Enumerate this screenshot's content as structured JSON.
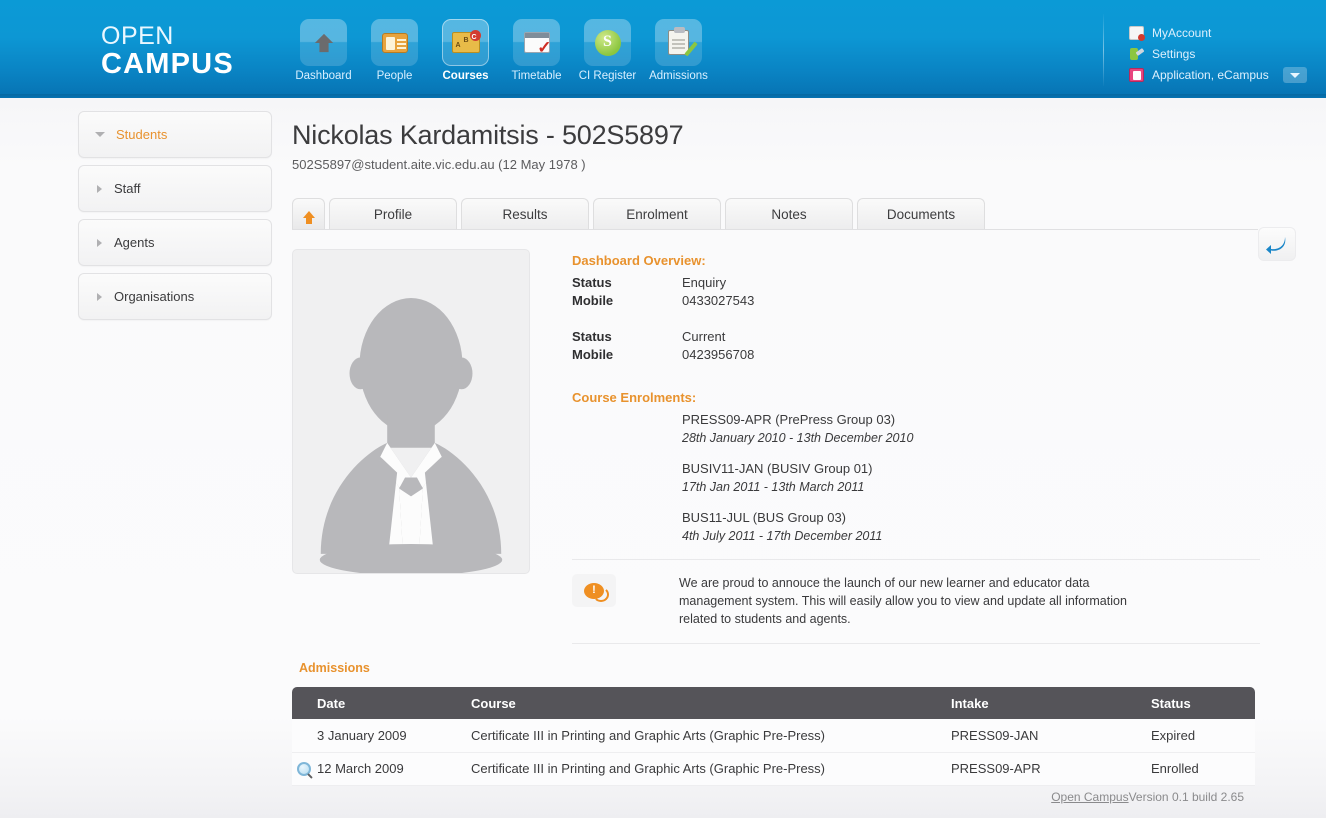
{
  "brand": {
    "line1": "OPEN",
    "line2": "CAMPUS"
  },
  "nav": {
    "items": [
      {
        "label": "Dashboard",
        "icon": "home-icon",
        "active": false
      },
      {
        "label": "People",
        "icon": "id-badge-icon",
        "active": false
      },
      {
        "label": "Courses",
        "icon": "folder-tabs-icon",
        "active": true
      },
      {
        "label": "Timetable",
        "icon": "calendar-check-icon",
        "active": false
      },
      {
        "label": "CI Register",
        "icon": "recycle-s-icon",
        "active": false
      },
      {
        "label": "Admissions",
        "icon": "clipboard-pen-icon",
        "active": false
      }
    ]
  },
  "account": {
    "items": [
      {
        "label": "MyAccount",
        "icon": "account-card-icon",
        "caret": false
      },
      {
        "label": "Settings",
        "icon": "settings-wrench-icon",
        "caret": false
      },
      {
        "label": "Application, eCampus",
        "icon": "application-icon",
        "caret": true
      }
    ]
  },
  "sidebar": {
    "items": [
      {
        "label": "Students",
        "state": "expanded",
        "active": true
      },
      {
        "label": "Staff",
        "state": "collapsed",
        "active": false
      },
      {
        "label": "Agents",
        "state": "collapsed",
        "active": false
      },
      {
        "label": "Organisations",
        "state": "collapsed",
        "active": false
      }
    ]
  },
  "student": {
    "title": "Nickolas Kardamitsis - 502S5897",
    "subtitle": "502S5897@student.aite.vic.edu.au (12 May 1978 )",
    "back_button_icon": "back-arrow-icon",
    "photo_alt": "person-placeholder-avatar"
  },
  "tabs": {
    "home_icon": "home-arrow-icon",
    "items": [
      {
        "label": "Profile",
        "active": false
      },
      {
        "label": "Results",
        "active": false
      },
      {
        "label": "Enrolment",
        "active": false
      },
      {
        "label": "Notes",
        "active": false
      },
      {
        "label": "Documents",
        "active": false
      }
    ]
  },
  "overview": {
    "heading": "Dashboard Overview:",
    "rows": [
      {
        "key": "Status",
        "value": "Enquiry"
      },
      {
        "key": "Mobile",
        "value": "0433027543"
      },
      {
        "key": "Status",
        "value": "Current"
      },
      {
        "key": "Mobile",
        "value": "0423956708"
      }
    ]
  },
  "enrolments": {
    "heading": "Course Enrolments:",
    "items": [
      {
        "name": "PRESS09-APR (PrePress Group 03)",
        "dates": "28th January 2010 - 13th December 2010"
      },
      {
        "name": "BUSIV11-JAN (BUSIV Group 01)",
        "dates": "17th Jan 2011 - 13th March 2011"
      },
      {
        "name": "BUS11-JUL (BUS Group 03)",
        "dates": "4th July 2011 - 17th December 2011"
      }
    ]
  },
  "announcement": {
    "icon": "speech-bubble-icon",
    "text": "We are proud to annouce the launch of our new learner and educator data management system. This will easily allow you to view and update all information related to students and agents."
  },
  "admissions": {
    "heading": "Admissions",
    "columns": [
      "Date",
      "Course",
      "Intake",
      "Status"
    ],
    "rows": [
      {
        "icon": "",
        "date": "3 January 2009",
        "course": "Certificate III in Printing and Graphic Arts (Graphic Pre-Press)",
        "intake": "PRESS09-JAN",
        "status": "Expired"
      },
      {
        "icon": "magnifier-icon",
        "date": "12 March 2009",
        "course": "Certificate III in Printing and Graphic Arts (Graphic Pre-Press)",
        "intake": "PRESS09-APR",
        "status": "Enrolled"
      }
    ]
  },
  "footer": {
    "link": "Open Campus",
    "version": " Version 0.1 build 2.65"
  },
  "colors": {
    "header_blue": "#0b9ad6",
    "accent_orange": "#e8922e",
    "table_header": "#555459"
  }
}
